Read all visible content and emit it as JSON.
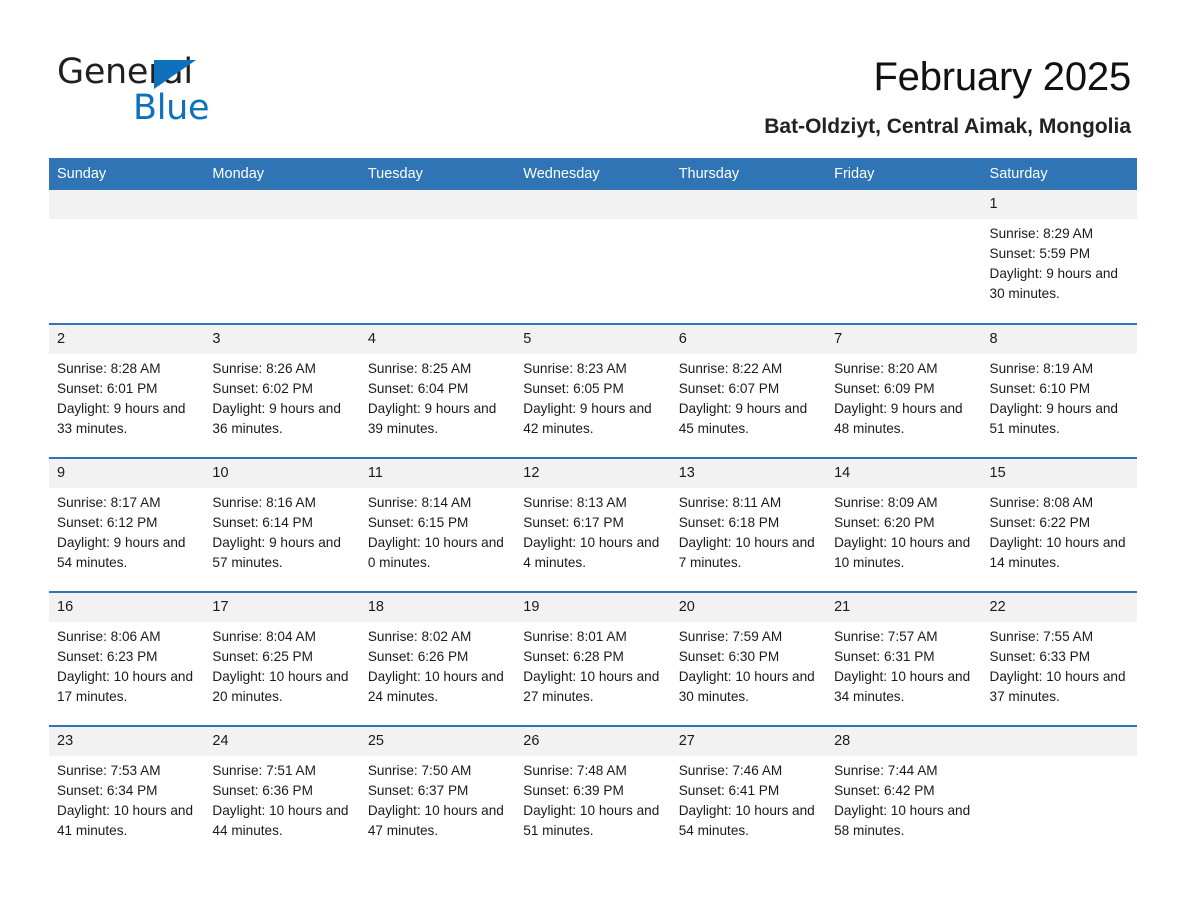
{
  "brand": {
    "name_black": "General",
    "name_blue": "Blue",
    "triangle_color": "#0d72bb"
  },
  "header": {
    "title": "February 2025",
    "subtitle": "Bat-Oldziyt, Central Aimak, Mongolia"
  },
  "theme": {
    "header_blue": "#2f74b5",
    "daynum_bg": "#f2f2f2",
    "page_bg": "#ffffff",
    "text": "#1a1a1a"
  },
  "weekdays": [
    "Sunday",
    "Monday",
    "Tuesday",
    "Wednesday",
    "Thursday",
    "Friday",
    "Saturday"
  ],
  "labels": {
    "sunrise_prefix": "Sunrise: ",
    "sunset_prefix": "Sunset: ",
    "daylight_prefix": "Daylight: "
  },
  "weeks": [
    [
      {
        "day": "",
        "blank": true
      },
      {
        "day": "",
        "blank": true
      },
      {
        "day": "",
        "blank": true
      },
      {
        "day": "",
        "blank": true
      },
      {
        "day": "",
        "blank": true
      },
      {
        "day": "",
        "blank": true
      },
      {
        "day": "1",
        "sunrise": "Sunrise: 8:29 AM",
        "sunset": "Sunset: 5:59 PM",
        "daylight": "Daylight: 9 hours and 30 minutes."
      }
    ],
    [
      {
        "day": "2",
        "sunrise": "Sunrise: 8:28 AM",
        "sunset": "Sunset: 6:01 PM",
        "daylight": "Daylight: 9 hours and 33 minutes."
      },
      {
        "day": "3",
        "sunrise": "Sunrise: 8:26 AM",
        "sunset": "Sunset: 6:02 PM",
        "daylight": "Daylight: 9 hours and 36 minutes."
      },
      {
        "day": "4",
        "sunrise": "Sunrise: 8:25 AM",
        "sunset": "Sunset: 6:04 PM",
        "daylight": "Daylight: 9 hours and 39 minutes."
      },
      {
        "day": "5",
        "sunrise": "Sunrise: 8:23 AM",
        "sunset": "Sunset: 6:05 PM",
        "daylight": "Daylight: 9 hours and 42 minutes."
      },
      {
        "day": "6",
        "sunrise": "Sunrise: 8:22 AM",
        "sunset": "Sunset: 6:07 PM",
        "daylight": "Daylight: 9 hours and 45 minutes."
      },
      {
        "day": "7",
        "sunrise": "Sunrise: 8:20 AM",
        "sunset": "Sunset: 6:09 PM",
        "daylight": "Daylight: 9 hours and 48 minutes."
      },
      {
        "day": "8",
        "sunrise": "Sunrise: 8:19 AM",
        "sunset": "Sunset: 6:10 PM",
        "daylight": "Daylight: 9 hours and 51 minutes."
      }
    ],
    [
      {
        "day": "9",
        "sunrise": "Sunrise: 8:17 AM",
        "sunset": "Sunset: 6:12 PM",
        "daylight": "Daylight: 9 hours and 54 minutes."
      },
      {
        "day": "10",
        "sunrise": "Sunrise: 8:16 AM",
        "sunset": "Sunset: 6:14 PM",
        "daylight": "Daylight: 9 hours and 57 minutes."
      },
      {
        "day": "11",
        "sunrise": "Sunrise: 8:14 AM",
        "sunset": "Sunset: 6:15 PM",
        "daylight": "Daylight: 10 hours and 0 minutes."
      },
      {
        "day": "12",
        "sunrise": "Sunrise: 8:13 AM",
        "sunset": "Sunset: 6:17 PM",
        "daylight": "Daylight: 10 hours and 4 minutes."
      },
      {
        "day": "13",
        "sunrise": "Sunrise: 8:11 AM",
        "sunset": "Sunset: 6:18 PM",
        "daylight": "Daylight: 10 hours and 7 minutes."
      },
      {
        "day": "14",
        "sunrise": "Sunrise: 8:09 AM",
        "sunset": "Sunset: 6:20 PM",
        "daylight": "Daylight: 10 hours and 10 minutes."
      },
      {
        "day": "15",
        "sunrise": "Sunrise: 8:08 AM",
        "sunset": "Sunset: 6:22 PM",
        "daylight": "Daylight: 10 hours and 14 minutes."
      }
    ],
    [
      {
        "day": "16",
        "sunrise": "Sunrise: 8:06 AM",
        "sunset": "Sunset: 6:23 PM",
        "daylight": "Daylight: 10 hours and 17 minutes."
      },
      {
        "day": "17",
        "sunrise": "Sunrise: 8:04 AM",
        "sunset": "Sunset: 6:25 PM",
        "daylight": "Daylight: 10 hours and 20 minutes."
      },
      {
        "day": "18",
        "sunrise": "Sunrise: 8:02 AM",
        "sunset": "Sunset: 6:26 PM",
        "daylight": "Daylight: 10 hours and 24 minutes."
      },
      {
        "day": "19",
        "sunrise": "Sunrise: 8:01 AM",
        "sunset": "Sunset: 6:28 PM",
        "daylight": "Daylight: 10 hours and 27 minutes."
      },
      {
        "day": "20",
        "sunrise": "Sunrise: 7:59 AM",
        "sunset": "Sunset: 6:30 PM",
        "daylight": "Daylight: 10 hours and 30 minutes."
      },
      {
        "day": "21",
        "sunrise": "Sunrise: 7:57 AM",
        "sunset": "Sunset: 6:31 PM",
        "daylight": "Daylight: 10 hours and 34 minutes."
      },
      {
        "day": "22",
        "sunrise": "Sunrise: 7:55 AM",
        "sunset": "Sunset: 6:33 PM",
        "daylight": "Daylight: 10 hours and 37 minutes."
      }
    ],
    [
      {
        "day": "23",
        "sunrise": "Sunrise: 7:53 AM",
        "sunset": "Sunset: 6:34 PM",
        "daylight": "Daylight: 10 hours and 41 minutes."
      },
      {
        "day": "24",
        "sunrise": "Sunrise: 7:51 AM",
        "sunset": "Sunset: 6:36 PM",
        "daylight": "Daylight: 10 hours and 44 minutes."
      },
      {
        "day": "25",
        "sunrise": "Sunrise: 7:50 AM",
        "sunset": "Sunset: 6:37 PM",
        "daylight": "Daylight: 10 hours and 47 minutes."
      },
      {
        "day": "26",
        "sunrise": "Sunrise: 7:48 AM",
        "sunset": "Sunset: 6:39 PM",
        "daylight": "Daylight: 10 hours and 51 minutes."
      },
      {
        "day": "27",
        "sunrise": "Sunrise: 7:46 AM",
        "sunset": "Sunset: 6:41 PM",
        "daylight": "Daylight: 10 hours and 54 minutes."
      },
      {
        "day": "28",
        "sunrise": "Sunrise: 7:44 AM",
        "sunset": "Sunset: 6:42 PM",
        "daylight": "Daylight: 10 hours and 58 minutes."
      },
      {
        "day": "",
        "blank": true
      }
    ]
  ]
}
